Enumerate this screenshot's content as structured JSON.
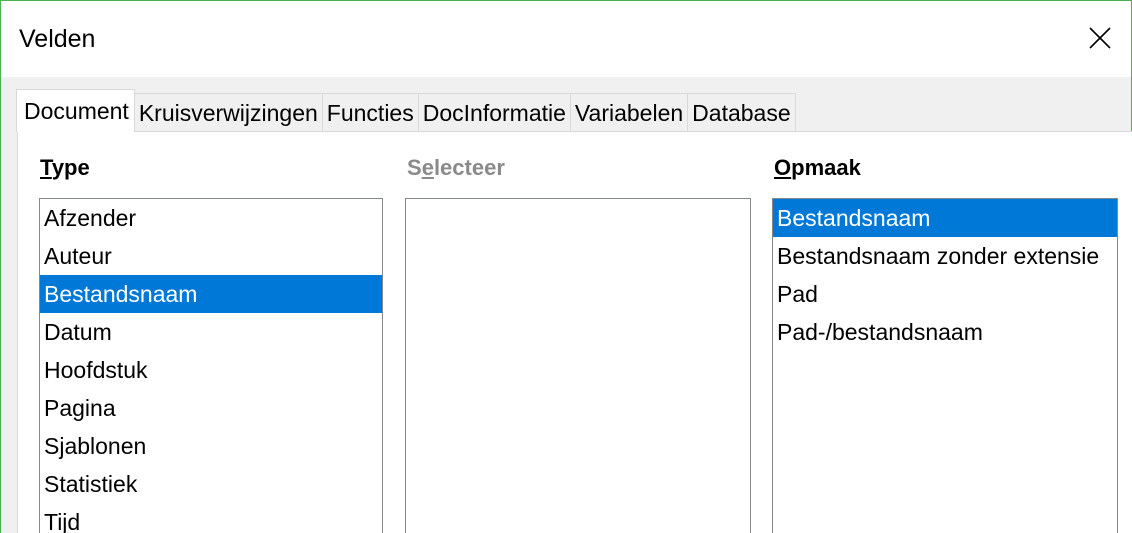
{
  "window": {
    "title": "Velden",
    "close_icon": "close-icon"
  },
  "tabs": [
    {
      "label": "Document",
      "active": true
    },
    {
      "label": "Kruisverwijzingen",
      "active": false
    },
    {
      "label": "Functies",
      "active": false
    },
    {
      "label": "DocInformatie",
      "active": false
    },
    {
      "label": "Variabelen",
      "active": false
    },
    {
      "label": "Database",
      "active": false
    }
  ],
  "type_column": {
    "header_mnemonic": "T",
    "header_rest": "ype",
    "items": [
      "Afzender",
      "Auteur",
      "Bestandsnaam",
      "Datum",
      "Hoofdstuk",
      "Pagina",
      "Sjablonen",
      "Statistiek",
      "Tijd"
    ],
    "selected": "Bestandsnaam"
  },
  "select_column": {
    "header_pre": "S",
    "header_mnemonic": "e",
    "header_rest": "lecteer",
    "items": []
  },
  "format_column": {
    "header_mnemonic": "O",
    "header_rest": "pmaak",
    "items": [
      "Bestandsnaam",
      "Bestandsnaam zonder extensie",
      "Pad",
      "Pad-/bestandsnaam"
    ],
    "selected": "Bestandsnaam"
  },
  "colors": {
    "selection": "#0078d7",
    "window_border": "#4caf50",
    "disabled_text": "#8a8a8a"
  }
}
